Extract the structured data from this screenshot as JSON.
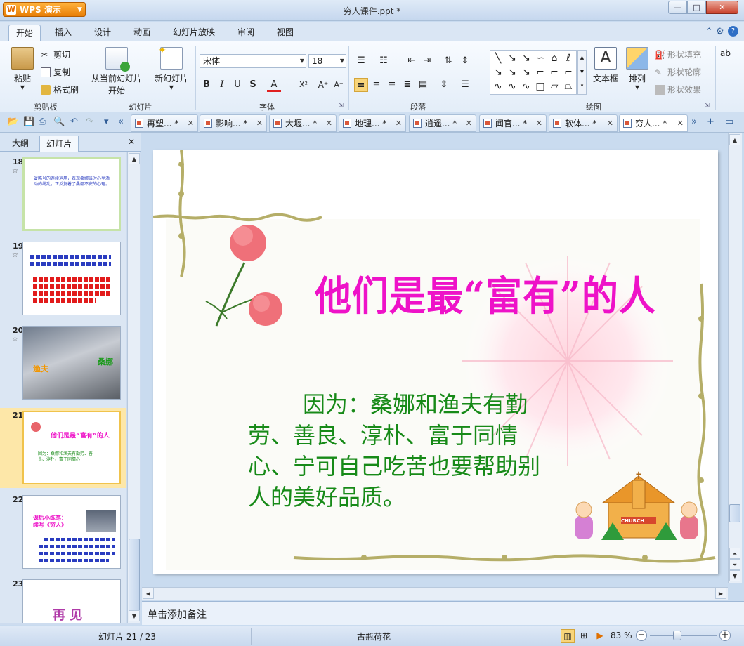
{
  "app": {
    "name": "WPS 演示",
    "document_title": "穷人课件.ppt *"
  },
  "window_controls": {
    "minimize": "—",
    "maximize": "□",
    "close": "✕"
  },
  "menu_tabs": [
    "开始",
    "插入",
    "设计",
    "动画",
    "幻灯片放映",
    "审阅",
    "视图"
  ],
  "ribbon": {
    "clipboard": {
      "paste": "粘贴",
      "cut": "剪切",
      "copy": "复制",
      "format_painter": "格式刷",
      "group": "剪贴板"
    },
    "slides": {
      "from_current": "从当前幻灯片",
      "from_current_2": "开始",
      "new_slide": "新幻灯片",
      "group": "幻灯片"
    },
    "font": {
      "name": "宋体",
      "size": "18",
      "group": "字体",
      "bold": "B",
      "italic": "I",
      "underline": "U",
      "shadow": "S",
      "color": "A",
      "super": "X²",
      "grow": "A⁺",
      "shrink": "A⁻"
    },
    "paragraph": {
      "group": "段落"
    },
    "drawing": {
      "textbox": "文本框",
      "arrange": "排列",
      "shape_fill": "形状填充",
      "shape_outline": "形状轮廓",
      "shape_effect": "形状效果",
      "group": "绘图",
      "more": "ab"
    }
  },
  "doc_tabs": [
    {
      "label": "再塑... *"
    },
    {
      "label": "影响... *"
    },
    {
      "label": "大堰... *"
    },
    {
      "label": "地理... *"
    },
    {
      "label": "逍遥... *"
    },
    {
      "label": "闻官... *"
    },
    {
      "label": "软体... *"
    },
    {
      "label": "穷人... *"
    }
  ],
  "left_pane": {
    "tabs": [
      "大纲",
      "幻灯片"
    ],
    "thumbnails": [
      {
        "num": "18",
        "star": "☆",
        "text": "省略号的连续运用，表现桑娜当时心里活动的纷乱，正反复着了桑娜不安的心理。"
      },
      {
        "num": "19",
        "star": "☆",
        "text": "抱走邻居孩子"
      },
      {
        "num": "20",
        "star": "☆",
        "label1": "渔夫",
        "label2": "桑娜"
      },
      {
        "num": "21",
        "title": "他们是最“富有”的人",
        "text": "因为：桑娜和渔夫有勤劳、善良、淳朴、富于同情心"
      },
      {
        "num": "22",
        "title": "课后小练笔：",
        "subtitle": "续写《穷人》"
      },
      {
        "num": "23",
        "text": "再 见"
      }
    ]
  },
  "slide": {
    "title": "他们是最“富有”的人",
    "body": "因为：桑娜和渔夫有勤劳、善良、淳朴、富于同情心、宁可自己吃苦也要帮助别人的美好品质。",
    "church_sign": "CHURCH"
  },
  "notes": {
    "placeholder": "单击添加备注"
  },
  "status": {
    "slide_info": "幻灯片 21 / 23",
    "theme": "古瓶荷花",
    "zoom": "83 %"
  },
  "colors": {
    "title": "#ee12c8",
    "body": "#178a18",
    "accent": "#e87e06"
  }
}
